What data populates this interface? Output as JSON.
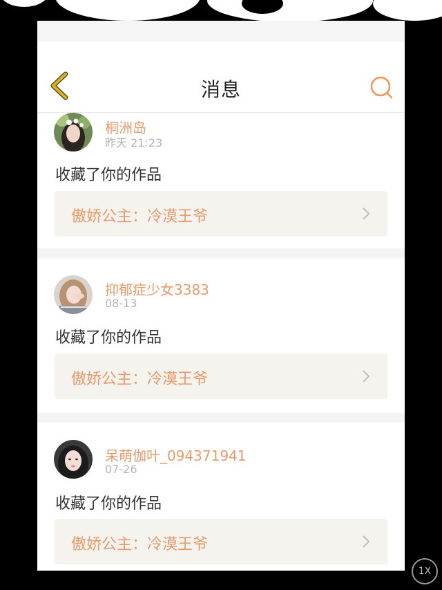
{
  "header": {
    "title": "消息"
  },
  "messages": [
    {
      "username": "桐洲岛",
      "time": "昨天 21:23",
      "action": "收藏了你的作品",
      "work_title": "傲娇公主：冷漠王爷"
    },
    {
      "username": "抑郁症少女3383",
      "time": "08-13",
      "action": "收藏了你的作品",
      "work_title": "傲娇公主：冷漠王爷"
    },
    {
      "username": "呆萌伽叶_094371941",
      "time": "07-26",
      "action": "收藏了你的作品",
      "work_title": "傲娇公主：冷漠王爷"
    }
  ],
  "overlay": {
    "speed_label": "1X"
  },
  "colors": {
    "accent": "#e89a6b",
    "back_icon": "#e0b400",
    "work_bg": "#f5f3ee"
  },
  "icons": {
    "back": "chevron-left-icon",
    "search": "search-icon",
    "work_arrow": "chevron-right-icon"
  }
}
